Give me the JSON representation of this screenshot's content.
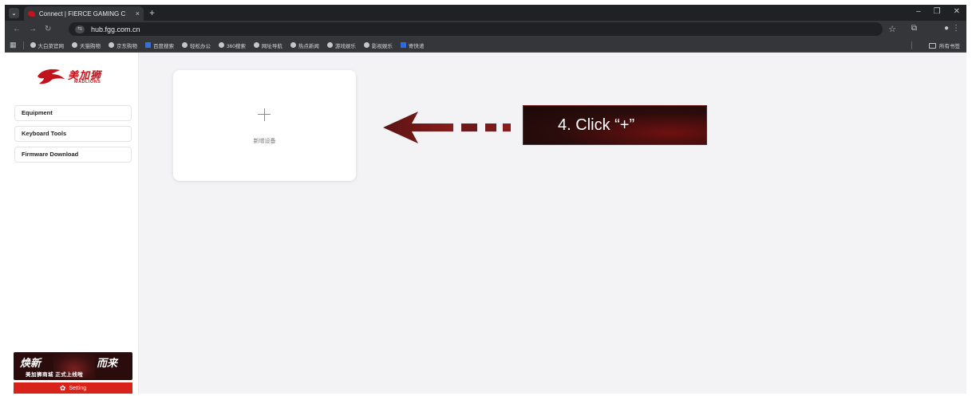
{
  "browser": {
    "tab_title": "Connect | FIERCE GAMING C",
    "tab_close": "×",
    "new_tab": "+",
    "url": "hub.fgg.com.cn",
    "bookmarks": [
      "大白菜官网",
      "天猫购物",
      "京东购物",
      "百度搜索",
      "轻松办公",
      "360搜索",
      "网址导航",
      "热点新闻",
      "游戏娱乐",
      "影视娱乐",
      "寄快递"
    ],
    "all_bookmarks": "所有书签"
  },
  "sidebar": {
    "logo_text": "美加狮",
    "logo_sub": "MADLIONS",
    "menu": [
      "Equipment",
      "Keyboard Tools",
      "Firmware Download"
    ],
    "promo": {
      "left": "焕新",
      "right": "而来",
      "subtitle": "美加狮商城 正式上线啦"
    },
    "setting_label": "Setting"
  },
  "main": {
    "add_device_label": "新增设备",
    "callout_text": "4. Click  “+”"
  },
  "colors": {
    "brand": "#c2141b",
    "setting_button": "#d8231a",
    "callout_bg": "#2a0c0c"
  }
}
